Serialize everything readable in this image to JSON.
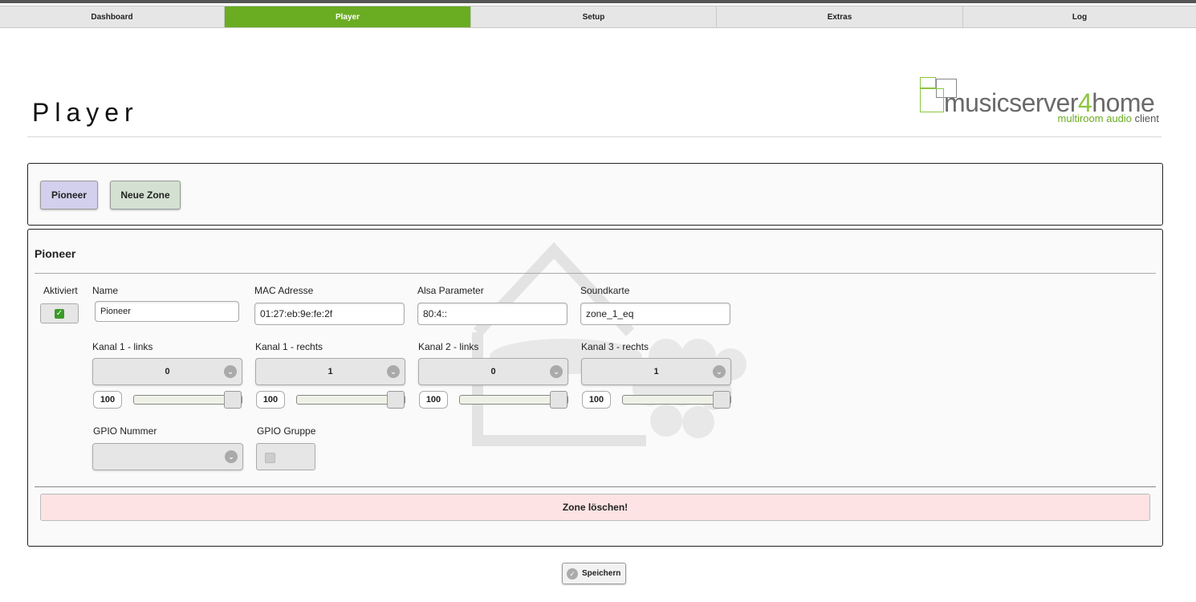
{
  "nav": {
    "tabs": [
      {
        "label": "Dashboard"
      },
      {
        "label": "Player"
      },
      {
        "label": "Setup"
      },
      {
        "label": "Extras"
      },
      {
        "label": "Log"
      }
    ]
  },
  "header": {
    "title": "Player",
    "logo": {
      "text_main": "musicserver",
      "text_num": "4",
      "text_end": "home",
      "sub_a": "multiroom audio",
      "sub_b": " client"
    }
  },
  "zones": {
    "buttons": [
      "Pioneer",
      "Neue Zone"
    ]
  },
  "zone": {
    "title": "Pioneer",
    "labels": {
      "active": "Aktiviert",
      "name": "Name",
      "mac": "MAC Adresse",
      "alsa": "Alsa Parameter",
      "soundcard": "Soundkarte",
      "gpio_num": "GPIO Nummer",
      "gpio_group": "GPIO Gruppe"
    },
    "values": {
      "active": true,
      "name": "Pioneer",
      "mac": "01:27:eb:9e:fe:2f",
      "alsa": "80:4::",
      "soundcard": "zone_1_eq"
    },
    "channels": [
      {
        "label": "Kanal 1 - links",
        "value": "0",
        "volume": "100"
      },
      {
        "label": "Kanal 1 - rechts",
        "value": "1",
        "volume": "100"
      },
      {
        "label": "Kanal 2 - links",
        "value": "0",
        "volume": "100"
      },
      {
        "label": "Kanal 3 - rechts",
        "value": "1",
        "volume": "100"
      }
    ],
    "delete_label": "Zone löschen!"
  },
  "footer": {
    "save_label": "Speichern"
  },
  "colors": {
    "nav_active": "#6aac22",
    "zone_pioneer": "#d2d0ec",
    "zone_new": "#d4e1d2",
    "delete_bg": "#fde3e3"
  },
  "icons": {
    "select_chevron": "chevron-down-icon",
    "checkbox": "check-icon",
    "save": "check-circle-icon"
  }
}
